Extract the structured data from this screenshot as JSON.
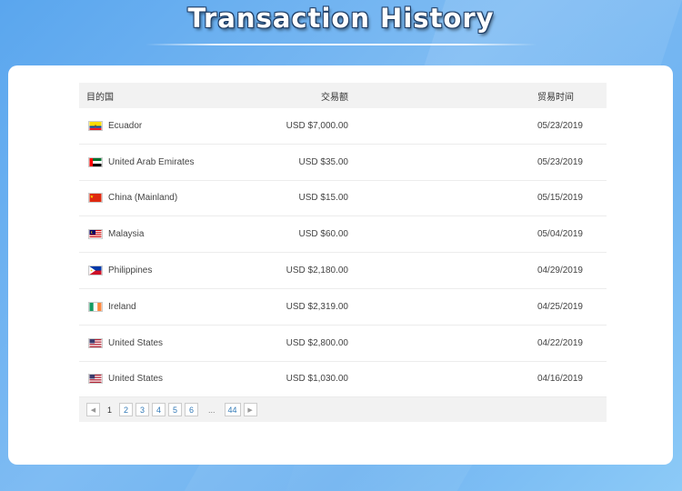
{
  "page": {
    "title": "Transaction History"
  },
  "table": {
    "headers": {
      "destination": "目的国",
      "amount": "交易额",
      "date": "贸易时间"
    },
    "rows": [
      {
        "country": "Ecuador",
        "flag": "ecuador-flag-icon",
        "amount": "USD $7,000.00",
        "date": "05/23/2019"
      },
      {
        "country": "United Arab Emirates",
        "flag": "uae-flag-icon",
        "amount": "USD $35.00",
        "date": "05/23/2019"
      },
      {
        "country": "China (Mainland)",
        "flag": "china-flag-icon",
        "amount": "USD $15.00",
        "date": "05/15/2019"
      },
      {
        "country": "Malaysia",
        "flag": "malaysia-flag-icon",
        "amount": "USD $60.00",
        "date": "05/04/2019"
      },
      {
        "country": "Philippines",
        "flag": "philippines-flag-icon",
        "amount": "USD $2,180.00",
        "date": "04/29/2019"
      },
      {
        "country": "Ireland",
        "flag": "ireland-flag-icon",
        "amount": "USD $2,319.00",
        "date": "04/25/2019"
      },
      {
        "country": "United States",
        "flag": "usa-flag-icon",
        "amount": "USD $2,800.00",
        "date": "04/22/2019"
      },
      {
        "country": "United States",
        "flag": "usa-flag-icon",
        "amount": "USD $1,030.00",
        "date": "04/16/2019"
      }
    ]
  },
  "pagination": {
    "prev_icon": "chevron-left-icon",
    "current": "1",
    "pages": [
      "2",
      "3",
      "4",
      "5",
      "6"
    ],
    "ellipsis": "...",
    "last": "44",
    "next_icon": "chevron-right-icon"
  },
  "colors": {
    "accent": "#337ab7",
    "header_bg": "#f2f2f2",
    "background": "#6fb3f1"
  }
}
